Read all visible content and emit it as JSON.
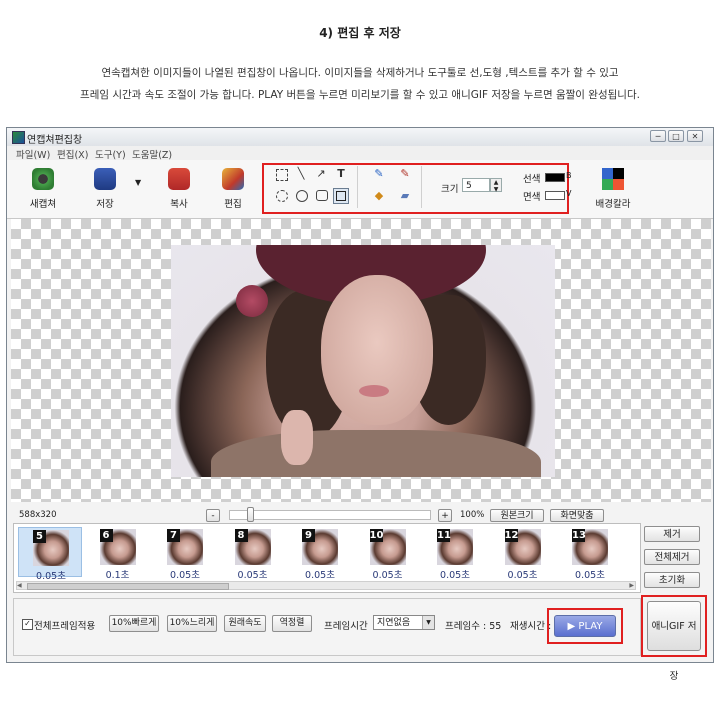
{
  "doc": {
    "heading": "4)  편집 후 저장",
    "line1": "연속캡쳐한 이미지들이 나열된 편집창이 나옵니다. 이미지들을 삭제하거나 도구툴로 선,도형 ,텍스트를 추가 할 수 있고",
    "line2": "프레임 시간과 속도 조절이 가능 합니다.  PLAY 버튼을 누르면 미리보기를 할 수 있고 애니GIF 저장을 누르면 움짤이 완성됩니다."
  },
  "window": {
    "title": "연캡쳐편집창",
    "controls": [
      "─",
      "□",
      "✕"
    ]
  },
  "menu": [
    "파일(W)",
    "편집(X)",
    "도구(Y)",
    "도움말(Z)"
  ],
  "toolbar": {
    "new_capture": "새캡쳐",
    "save": "저장",
    "copy": "복사",
    "edit": "편집",
    "size_label": "크기",
    "size_value": "5",
    "line_color_label": "선색",
    "line_color_key": "B",
    "fill_color_label": "면색",
    "fill_color_key": "V",
    "background_color": "배경칼라"
  },
  "canvas": {
    "dimensions": "588x320",
    "zoom_percent": "100%",
    "zoom_minus": "-",
    "zoom_plus": "+",
    "original_size": "원본크기",
    "fit_screen": "화면맞춤"
  },
  "frames": [
    {
      "num": "5",
      "duration": "0.05초",
      "selected": true
    },
    {
      "num": "6",
      "duration": "0.1초",
      "selected": false
    },
    {
      "num": "7",
      "duration": "0.05초",
      "selected": false
    },
    {
      "num": "8",
      "duration": "0.05초",
      "selected": false
    },
    {
      "num": "9",
      "duration": "0.05초",
      "selected": false
    },
    {
      "num": "10",
      "duration": "0.05초",
      "selected": false
    },
    {
      "num": "11",
      "duration": "0.05초",
      "selected": false
    },
    {
      "num": "12",
      "duration": "0.05초",
      "selected": false
    },
    {
      "num": "13",
      "duration": "0.05초",
      "selected": false
    }
  ],
  "side": {
    "remove": "제거",
    "remove_all": "전체제거",
    "reset": "초기화"
  },
  "bottom": {
    "apply_all_frames": "전체프레임적용",
    "apply_all_checked": true,
    "faster": "10%빠르게",
    "slower": "10%느리게",
    "original_speed": "원래속도",
    "reverse": "역정렬",
    "frame_time_label": "프레임시간",
    "frame_time_value": "지연없음",
    "frame_count": "프레임수 :  55",
    "play_time_label": "재생시간 :",
    "play": "PLAY",
    "save_gif": "애니GIF 저장"
  },
  "colors": {
    "accent_red": "#e02020",
    "play_blue": "#5a6fcf",
    "duration_text": "#2a3a78"
  }
}
